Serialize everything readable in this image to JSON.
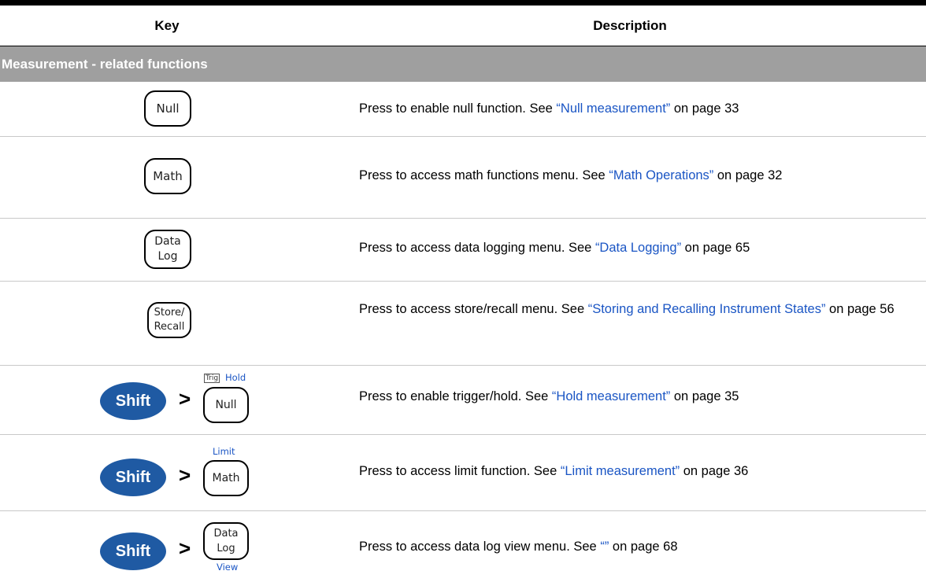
{
  "table": {
    "header": {
      "key": "Key",
      "description": "Description"
    },
    "section_title": "Measurement - related functions",
    "rows": [
      {
        "key": "Null",
        "desc_prefix": "Press to enable null function. See ",
        "link": "“Null measurement”",
        "desc_suffix": " on page 33"
      },
      {
        "key": "Math",
        "desc_prefix": "Press to access math functions menu. See ",
        "link": "“Math Operations”",
        "desc_suffix": " on page 32"
      },
      {
        "key_line1": "Data",
        "key_line2": "Log",
        "desc_prefix": "Press to access data logging menu. See ",
        "link": "“Data Logging”",
        "desc_suffix": " on page 65"
      },
      {
        "key_line1": "Store/",
        "key_line2": "Recall",
        "desc_prefix": "Press to access store/recall menu. See ",
        "link": "“Storing and Recalling Instrument States”",
        "desc_suffix": " on page 56"
      },
      {
        "shift": "Shift",
        "sep": ">",
        "trig": "Trig",
        "alt": "Hold",
        "key": "Null",
        "desc_prefix": "Press to enable trigger/hold. See ",
        "link": "“Hold measurement”",
        "desc_suffix": " on page 35"
      },
      {
        "shift": "Shift",
        "sep": ">",
        "alt": "Limit",
        "key": "Math",
        "desc_prefix": "Press to access limit function. See ",
        "link": "“Limit measurement”",
        "desc_suffix": " on page 36"
      },
      {
        "shift": "Shift",
        "sep": ">",
        "key_line1": "Data",
        "key_line2": "Log",
        "alt": "View",
        "desc_prefix": "Press to access data log view menu. See ",
        "link": "“”",
        "desc_suffix": " on page 68"
      }
    ]
  }
}
